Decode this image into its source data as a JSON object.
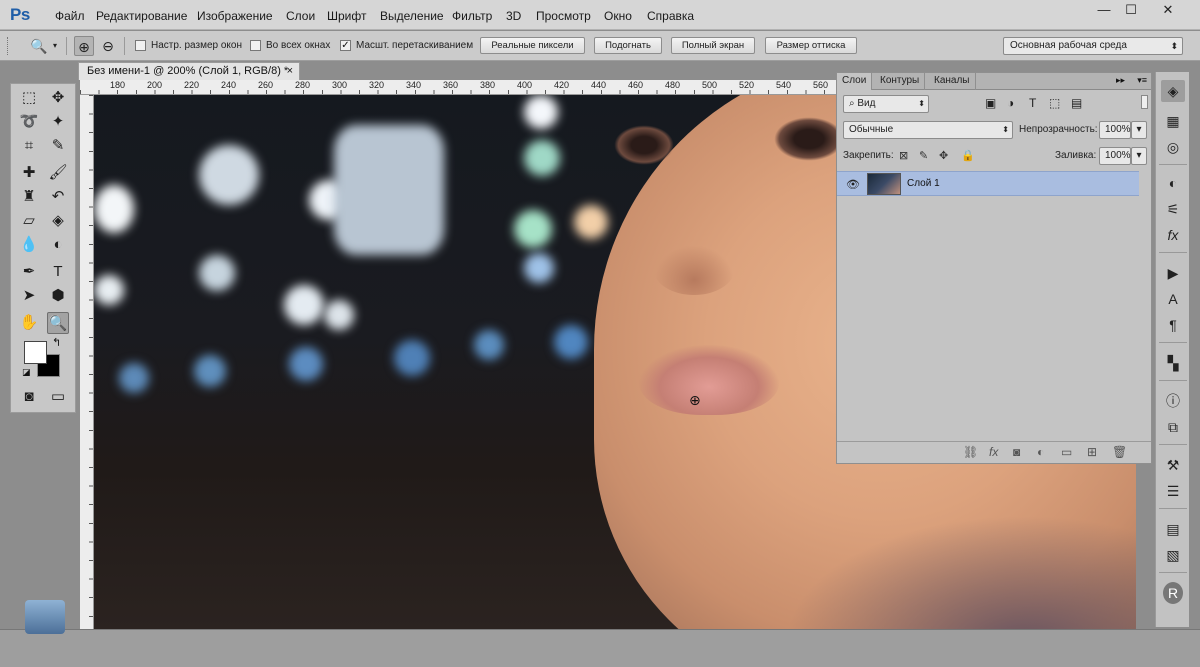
{
  "app": {
    "logo": "Ps"
  },
  "menu": [
    "Файл",
    "Редактирование",
    "Изображение",
    "Слои",
    "Шрифт",
    "Выделение",
    "Фильтр",
    "3D",
    "Просмотр",
    "Окно",
    "Справка"
  ],
  "window_controls": {
    "minimize": "—",
    "maximize": "☐",
    "close": "✕"
  },
  "options_bar": {
    "tool_icon": "zoom-icon",
    "zoom_in": "zoom-in-icon",
    "zoom_out": "zoom-out-icon",
    "checkboxes": [
      {
        "label": "Настр. размер окон",
        "checked": false
      },
      {
        "label": "Во всех окнах",
        "checked": false
      },
      {
        "label": "Масшт. перетаскиванием",
        "checked": true
      }
    ],
    "buttons": [
      "Реальные пиксели",
      "Подогнать",
      "Полный экран",
      "Размер оттиска"
    ],
    "workspace": "Основная рабочая среда"
  },
  "document": {
    "tab_title": "Без имени-1 @ 200% (Слой 1, RGB/8) *",
    "close": "×",
    "ruler_ticks": [
      "180",
      "200",
      "220",
      "240",
      "260",
      "280",
      "300",
      "320",
      "340",
      "360",
      "380",
      "400",
      "420",
      "440",
      "460",
      "480",
      "500",
      "520",
      "540",
      "560"
    ]
  },
  "layers_panel": {
    "tabs": [
      "Слои",
      "Контуры",
      "Каналы"
    ],
    "active_tab": "Слои",
    "filter_kind": "Вид",
    "blend_mode": "Обычные",
    "opacity_label": "Непрозрачность:",
    "opacity_value": "100%",
    "lock_label": "Закрепить:",
    "fill_label": "Заливка:",
    "fill_value": "100%",
    "layers": [
      {
        "name": "Слой 1",
        "visible": true,
        "selected": true
      }
    ]
  },
  "colors": {
    "foreground": "#ffffff",
    "background": "#000000",
    "layer_selected": "#a9bde0"
  }
}
